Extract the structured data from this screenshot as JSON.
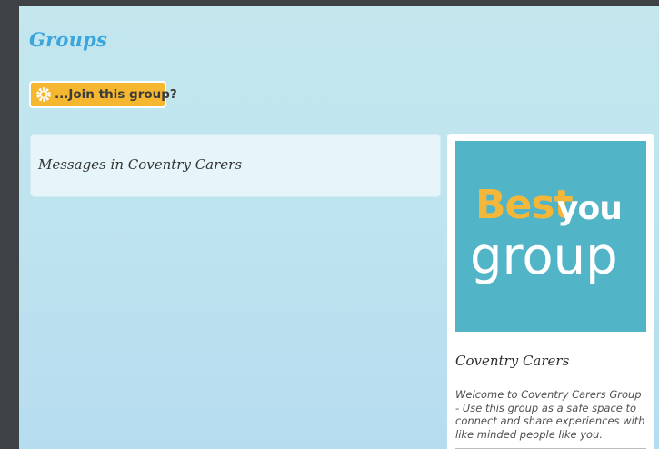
{
  "page": {
    "title": "Groups",
    "join_button": {
      "label": "...Join this group?",
      "icon": "gear-icon"
    }
  },
  "messages": {
    "title": "Messages in Coventry Carers"
  },
  "group_card": {
    "logo": {
      "word_best": "Best",
      "word_you": "you",
      "word_group": "group"
    },
    "name": "Coventry Carers",
    "description": "Welcome to Coventry Carers Group - Use this group as a safe space to connect and share experiences with like minded people like you."
  },
  "colors": {
    "accent": "#3aa6dd",
    "button": "#f6b730",
    "logo_bg": "#52b4c7",
    "logo_best": "#f4b73a"
  }
}
